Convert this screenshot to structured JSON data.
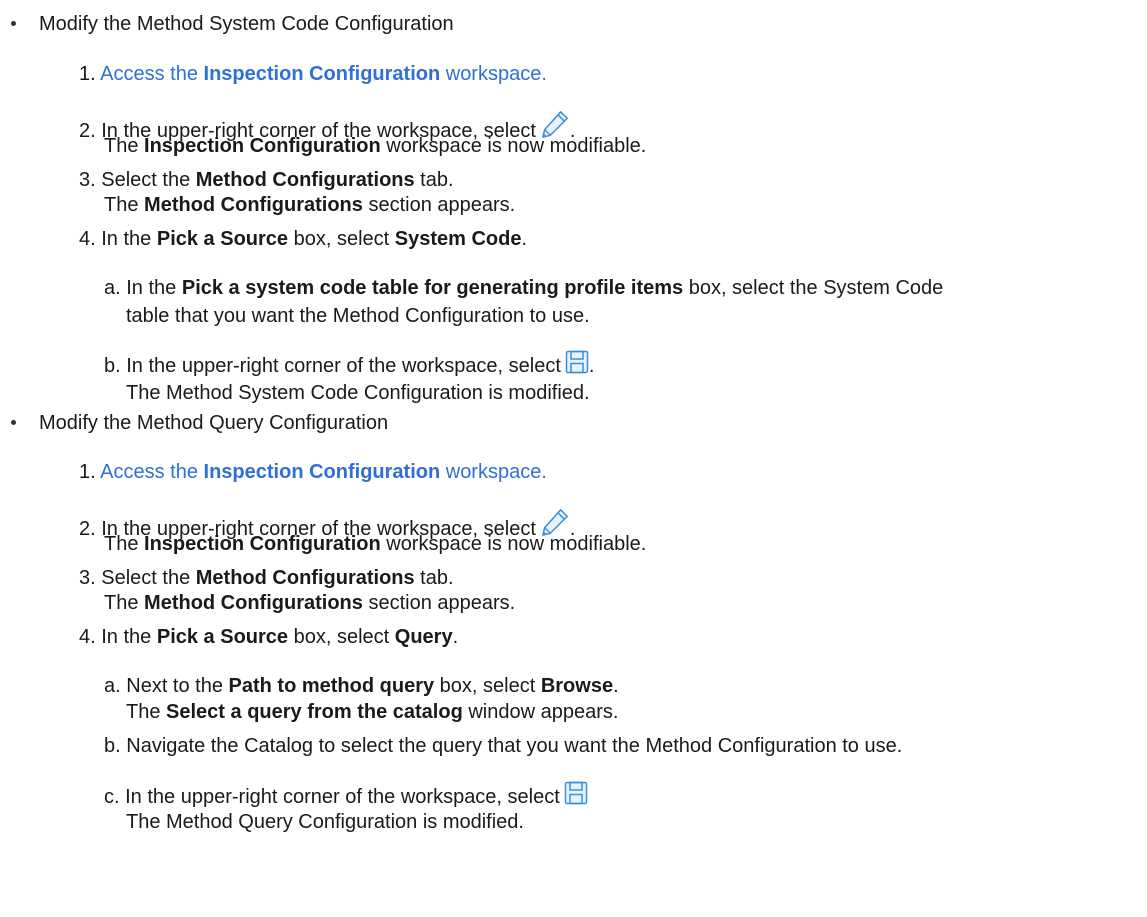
{
  "section1": {
    "heading": "Modify the Method System Code Configuration",
    "step1": {
      "num": "1.",
      "pre": "Access the ",
      "bold": "Inspection Configuration",
      "post": " workspace."
    },
    "step2": {
      "num": "2.",
      "text": "In the upper-right corner of the workspace, select",
      "after_icon": ".",
      "icon": "pencil-icon",
      "result_pre": "The ",
      "result_bold": "Inspection Configuration",
      "result_post": " workspace is now modifiable."
    },
    "step3": {
      "num": "3.",
      "pre": "Select the ",
      "bold": "Method Configurations",
      "post": " tab.",
      "result_pre": "The ",
      "result_bold": "Method Configurations",
      "result_post": " section appears."
    },
    "step4": {
      "num": "4.",
      "pre": "In the ",
      "bold1": "Pick a Source",
      "mid": " box, select ",
      "bold2": "System Code",
      "post": "."
    },
    "substep_a": {
      "letter": "a.",
      "pre": "In the ",
      "bold": "Pick a system code table for generating profile items",
      "post": " box, select the System Code",
      "line2": "table that you want the Method Configuration to use."
    },
    "substep_b": {
      "letter": "b.",
      "text": "In the upper-right corner of the workspace, select",
      "after_icon": ".",
      "icon": "save-icon",
      "result": "The Method System Code Configuration is modified."
    }
  },
  "section2": {
    "heading": "Modify the Method Query Configuration",
    "step1": {
      "num": "1.",
      "pre": "Access the ",
      "bold": "Inspection Configuration",
      "post": " workspace."
    },
    "step2": {
      "num": "2.",
      "text": "In the upper-right corner of the workspace, select",
      "after_icon": ".",
      "icon": "pencil-icon",
      "result_pre": "The ",
      "result_bold": "Inspection Configuration",
      "result_post": " workspace is now modifiable."
    },
    "step3": {
      "num": "3.",
      "pre": "Select the ",
      "bold": "Method Configurations",
      "post": " tab.",
      "result_pre": "The ",
      "result_bold": "Method Configurations",
      "result_post": " section appears."
    },
    "step4": {
      "num": "4.",
      "pre": "In the ",
      "bold1": "Pick a Source",
      "mid": " box, select ",
      "bold2": "Query",
      "post": "."
    },
    "substep_a": {
      "letter": "a.",
      "pre": "Next to the ",
      "bold1": "Path to method query",
      "mid": " box, select ",
      "bold2": "Browse",
      "post": ".",
      "result_pre": "The ",
      "result_bold": "Select a query from the catalog",
      "result_post": " window appears."
    },
    "substep_b": {
      "letter": "b.",
      "text": "Navigate the Catalog to select the query that you want the Method Configuration to use."
    },
    "substep_c": {
      "letter": "c.",
      "text": "In the upper-right corner of the workspace, select",
      "icon": "save-icon",
      "result": "The Method Query Configuration is modified."
    }
  },
  "colors": {
    "text": "#1a1a1a",
    "link": "#2f6fd6",
    "icon_blue": "#3b8fd9"
  }
}
